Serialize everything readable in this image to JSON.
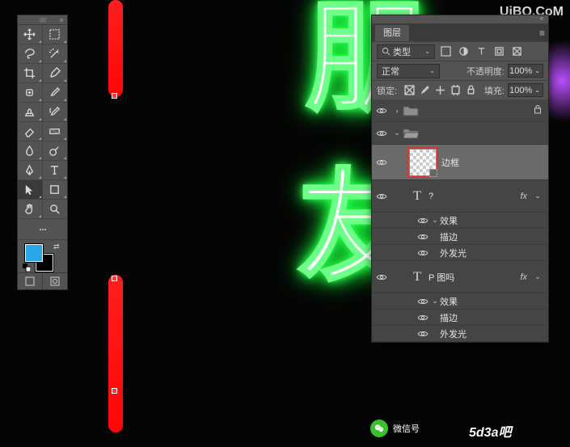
{
  "watermark": "UiBQ.CoM",
  "canvas": {
    "neon_char_top": "朋",
    "neon_char_bottom": "友"
  },
  "swatch": {
    "foreground": "#2aa7e8",
    "background": "#000000"
  },
  "layers_panel": {
    "tab_label": "图层",
    "filter": {
      "kind_label": "类型"
    },
    "blend": {
      "mode_label": "正常",
      "opacity_label": "不透明度:",
      "opacity_value": "100%"
    },
    "lock": {
      "label": "锁定:",
      "fill_label": "填充:",
      "fill_value": "100%"
    },
    "items": {
      "group_top_name": "",
      "layer_frame": "边框",
      "layer_text_q": "?",
      "fx_label": "效果",
      "fx_stroke": "描边",
      "fx_outerglow": "外发光",
      "layer_text_p": "P 图吗",
      "fx_badge": "fx"
    }
  },
  "wechat": {
    "label": "微信号"
  },
  "logo_overlay": "5d3a吧"
}
